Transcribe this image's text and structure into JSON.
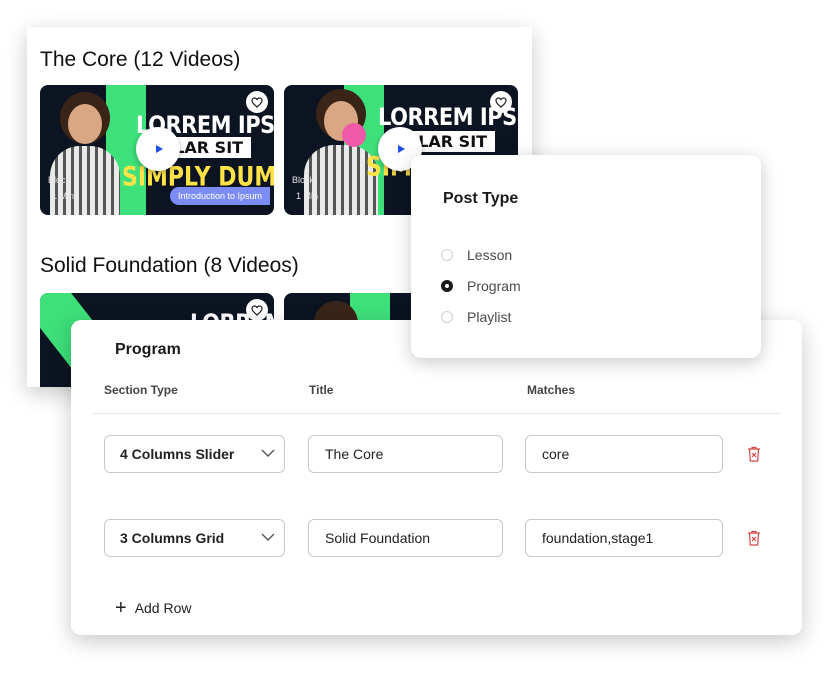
{
  "video_panel": {
    "sections": [
      {
        "title": "The Core  (12 Videos)",
        "thumbnails": [
          {
            "headline": "LORREM IPSUM",
            "subline": "LLAR SIT",
            "yellow_line": "SIMPLY DUMMY",
            "tag": "Block",
            "duration": "1 Min",
            "pill": "Introduction to Ipsum"
          },
          {
            "headline": "LORREM IPSUM",
            "subline": "LLAR SIT",
            "yellow_line": "SIM",
            "tag": "Block",
            "duration": "1 Min"
          }
        ]
      },
      {
        "title": "Solid Foundation  (8 Videos)",
        "thumbnails": [
          {
            "headline": "LORREM IPSUM"
          },
          {
            "headline": ""
          }
        ]
      }
    ]
  },
  "post_type": {
    "title": "Post Type",
    "options": [
      "Lesson",
      "Program",
      "Playlist"
    ],
    "selected": "Program"
  },
  "program": {
    "title": "Program",
    "columns": {
      "section_type": "Section Type",
      "title": "Title",
      "matches": "Matches"
    },
    "rows": [
      {
        "section_type": "4 Columns Slider",
        "title": "The Core",
        "matches": "core"
      },
      {
        "section_type": "3 Columns Grid",
        "title": "Solid Foundation",
        "matches": "foundation,stage1"
      }
    ],
    "add_row_label": "Add Row"
  },
  "colors": {
    "accent_green": "#3ee07a",
    "thumbnail_bg": "#0c1422",
    "play_blue": "#1f4fe0",
    "pill_purple": "#7c8cf7",
    "delete_red": "#d64545"
  },
  "icons": [
    "play-icon",
    "heart-icon",
    "chevron-down-icon",
    "trash-icon",
    "plus-icon"
  ]
}
